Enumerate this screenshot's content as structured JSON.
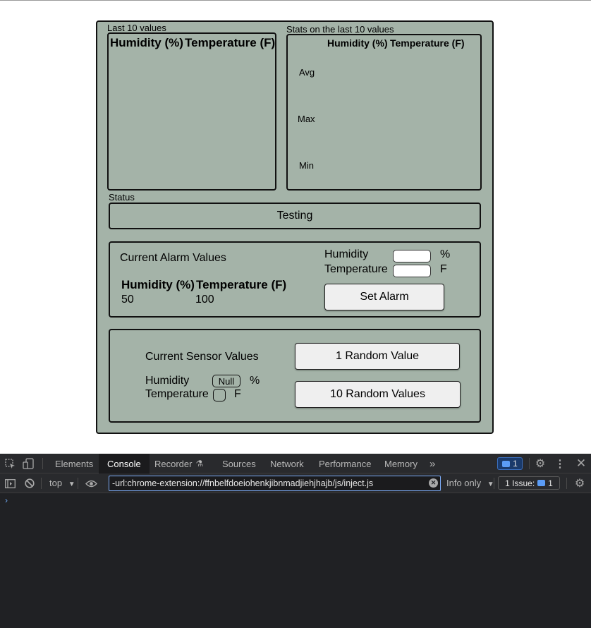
{
  "app": {
    "last_values": {
      "title": "Last 10 values",
      "col_humidity": "Humidity (%)",
      "col_temperature": "Temperature (F)"
    },
    "stats": {
      "title": "Stats on the last 10 values",
      "col_humidity": "Humidity (%)",
      "col_temperature": "Temperature (F)",
      "rows": [
        "Avg",
        "Max",
        "Min"
      ]
    },
    "status": {
      "label": "Status",
      "value": "Testing"
    },
    "alarm": {
      "title": "Current Alarm Values",
      "col_humidity": "Humidity (%)",
      "col_temperature": "Temperature (F)",
      "humidity_value": "50",
      "temperature_value": "100",
      "humidity_label": "Humidity",
      "humidity_unit": "%",
      "temperature_label": "Temperature",
      "temperature_unit": "F",
      "set_button": "Set Alarm"
    },
    "sensor": {
      "title": "Current Sensor Values",
      "humidity_label": "Humidity",
      "humidity_value": "Null",
      "humidity_unit": "%",
      "temperature_label": "Temperature",
      "temperature_value": "",
      "temperature_unit": "F",
      "one_random_button": "1 Random Value",
      "ten_random_button": "10 Random Values"
    }
  },
  "devtools": {
    "tabs": [
      "Elements",
      "Console",
      "Recorder",
      "Sources",
      "Network",
      "Performance",
      "Memory"
    ],
    "active_tab": "Console",
    "more_tabs": "»",
    "message_count": "1",
    "context": "top",
    "filter_value": "-url:chrome-extension://ffnbelfdoeiohenkjibnmadjiehjhajb/js/inject.js",
    "log_level": "Info only",
    "issues_label": "1 Issue:",
    "issues_count": "1",
    "prompt": "›"
  },
  "colors": {
    "panel_bg": "#a4b3a8",
    "devtools_bg": "#202124",
    "devtools_toolbar": "#292a2d",
    "accent_blue": "#7cacf8"
  }
}
